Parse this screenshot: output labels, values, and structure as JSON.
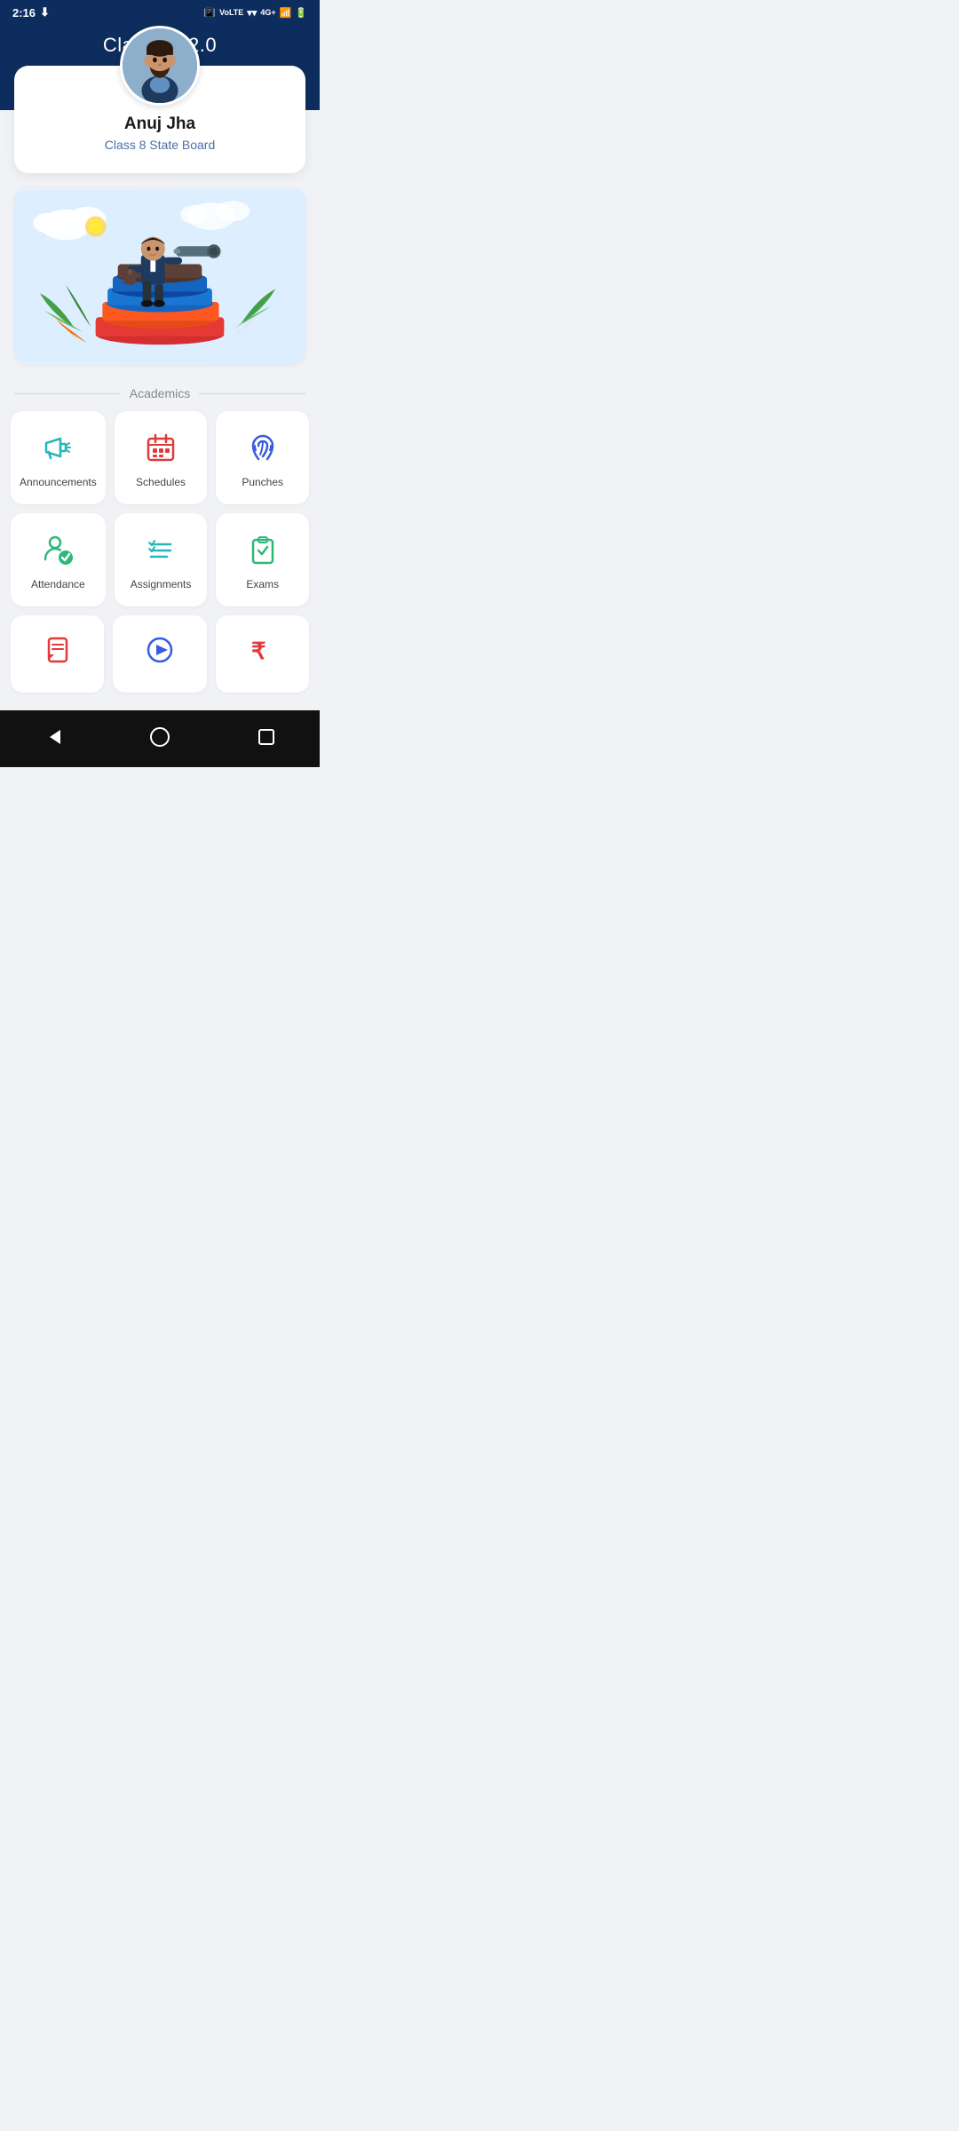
{
  "statusBar": {
    "time": "2:16",
    "download_icon": "↓"
  },
  "header": {
    "title": "Classbot 2.0"
  },
  "profile": {
    "name": "Anuj Jha",
    "class": "Class 8 State Board"
  },
  "sections": {
    "academics_label": "Academics"
  },
  "gridItems": [
    {
      "id": "announcements",
      "label": "Announcements",
      "iconClass": "icon-announcements"
    },
    {
      "id": "schedules",
      "label": "Schedules",
      "iconClass": "icon-schedules"
    },
    {
      "id": "punches",
      "label": "Punches",
      "iconClass": "icon-punches"
    },
    {
      "id": "attendance",
      "label": "Attendance",
      "iconClass": "icon-attendance"
    },
    {
      "id": "assignments",
      "label": "Assignments",
      "iconClass": "icon-assignments"
    },
    {
      "id": "exams",
      "label": "Exams",
      "iconClass": "icon-exams"
    }
  ],
  "partialItems": [
    {
      "id": "notes",
      "label": "Notes",
      "iconClass": "icon-notes"
    },
    {
      "id": "video",
      "label": "Video",
      "iconClass": "icon-video"
    },
    {
      "id": "fees",
      "label": "Fees",
      "iconClass": "icon-fees"
    }
  ]
}
